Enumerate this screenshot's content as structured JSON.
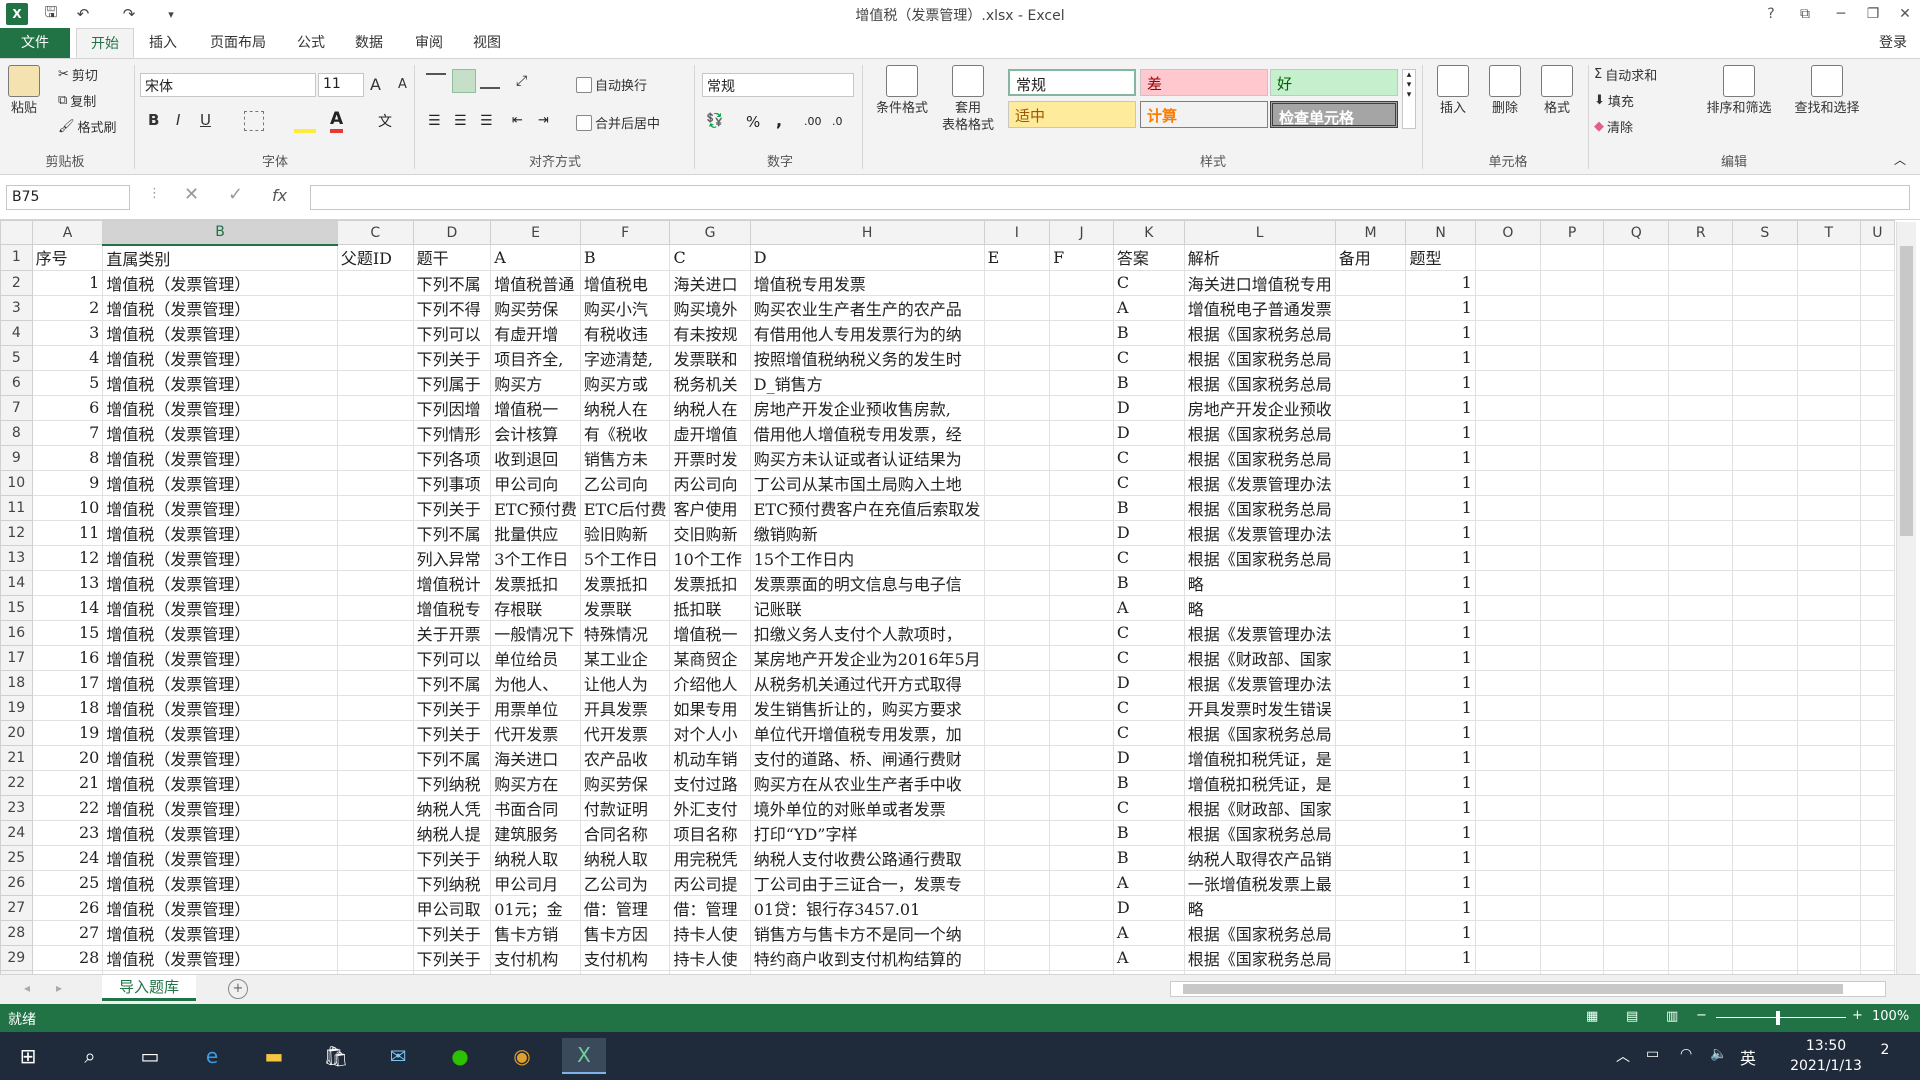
{
  "window": {
    "title": "增值税（发票管理）.xlsx - Excel",
    "login": "登录",
    "help": "?",
    "restore_ribbon": "⧉",
    "minimize": "─",
    "maximize": "❐",
    "close": "✕"
  },
  "qat": {
    "save_icon": "save-icon",
    "undo_icon": "undo-icon",
    "redo_icon": "redo-icon"
  },
  "tabs": [
    "文件",
    "开始",
    "插入",
    "页面布局",
    "公式",
    "数据",
    "审阅",
    "视图"
  ],
  "ribbon": {
    "clipboard": {
      "paste": "粘贴",
      "cut": "剪切",
      "copy": "复制",
      "format_painter": "格式刷",
      "label": "剪贴板"
    },
    "font": {
      "name": "宋体",
      "size": "11",
      "bold": "B",
      "italic": "I",
      "underline": "U",
      "grow": "A",
      "shrink": "A",
      "label": "字体"
    },
    "align": {
      "wrap": "自动换行",
      "merge": "合并后居中",
      "label": "对齐方式"
    },
    "number": {
      "format": "常规",
      "percent": "%",
      "comma": ",",
      "label": "数字"
    },
    "styles": {
      "cond": "条件格式",
      "table": "套用",
      "table2": "表格格式",
      "normal": "常规",
      "bad": "差",
      "good": "好",
      "neutral": "适中",
      "calc": "计算",
      "check": "检查单元格",
      "label": "样式"
    },
    "cells": {
      "insert": "插入",
      "delete": "删除",
      "format": "格式",
      "label": "单元格"
    },
    "editing": {
      "autosum": "自动求和",
      "fill": "填充",
      "clear": "清除",
      "sort": "排序和筛选",
      "find": "查找和选择",
      "label": "编辑"
    }
  },
  "formula_bar": {
    "name_box": "B75",
    "cancel": "✕",
    "enter": "✓",
    "fx": "fx",
    "value": ""
  },
  "columns": [
    "A",
    "B",
    "C",
    "D",
    "E",
    "F",
    "G",
    "H",
    "I",
    "J",
    "K",
    "L",
    "M",
    "N",
    "O",
    "P",
    "Q",
    "R",
    "S",
    "T",
    "U"
  ],
  "header_row": [
    "序号",
    "直属类别",
    "父题ID",
    "题干",
    "A",
    "B",
    "C",
    "D",
    "E",
    "F",
    "答案",
    "解析",
    "备用",
    "题型"
  ],
  "rows": [
    [
      "1",
      "增值税（发票管理）",
      "",
      "下列不属",
      "增值税普通",
      "增值税电",
      "海关进口",
      "增值税专用发票",
      "",
      "",
      "C",
      "海关进口增值税专用",
      "",
      "1"
    ],
    [
      "2",
      "增值税（发票管理）",
      "",
      "下列不得",
      "购买劳保",
      "购买小汽",
      "购买境外",
      "购买农业生产者生产的农产品",
      "",
      "",
      "A",
      "增值税电子普通发票",
      "",
      "1"
    ],
    [
      "3",
      "增值税（发票管理）",
      "",
      "下列可以",
      "有虚开增",
      "有税收违",
      "有未按规",
      "有借用他人专用发票行为的纳",
      "",
      "",
      "B",
      "根据《国家税务总局",
      "",
      "1"
    ],
    [
      "4",
      "增值税（发票管理）",
      "",
      "下列关于",
      "项目齐全,",
      "字迹清楚,",
      "发票联和",
      "按照增值税纳税义务的发生时",
      "",
      "",
      "C",
      "根据《国家税务总局",
      "",
      "1"
    ],
    [
      "5",
      "增值税（发票管理）",
      "",
      "下列属于",
      "购买方",
      "购买方或",
      "税务机关",
      "D_销售方",
      "",
      "",
      "B",
      "根据《国家税务总局",
      "",
      "1"
    ],
    [
      "6",
      "增值税（发票管理）",
      "",
      "下列因增",
      "增值税一",
      "纳税人在",
      "纳税人在",
      "房地产开发企业预收售房款,",
      "",
      "",
      "D",
      "房地产开发企业预收",
      "",
      "1"
    ],
    [
      "7",
      "增值税（发票管理）",
      "",
      "下列情形",
      "会计核算",
      "有《税收",
      "虚开增值",
      "借用他人增值税专用发票，经",
      "",
      "",
      "D",
      "根据《国家税务总局",
      "",
      "1"
    ],
    [
      "8",
      "增值税（发票管理）",
      "",
      "下列各项",
      "收到退回",
      "销售方未",
      "开票时发",
      "购买方未认证或者认证结果为",
      "",
      "",
      "C",
      "根据《国家税务总局",
      "",
      "1"
    ],
    [
      "9",
      "增值税（发票管理）",
      "",
      "下列事项",
      "甲公司向",
      "乙公司向",
      "丙公司向",
      "丁公司从某市国土局购入土地",
      "",
      "",
      "C",
      "根据《发票管理办法",
      "",
      "1"
    ],
    [
      "10",
      "增值税（发票管理）",
      "",
      "下列关于",
      "ETC预付费",
      "ETC后付费",
      "客户使用",
      "ETC预付费客户在充值后索取发",
      "",
      "",
      "B",
      "根据《国家税务总局",
      "",
      "1"
    ],
    [
      "11",
      "增值税（发票管理）",
      "",
      "下列不属",
      "批量供应",
      "验旧购新",
      "交旧购新",
      "缴销购新",
      "",
      "",
      "D",
      "根据《发票管理办法",
      "",
      "1"
    ],
    [
      "12",
      "增值税（发票管理）",
      "",
      "列入异常",
      "3个工作日",
      "5个工作日",
      "10个工作",
      "15个工作日内",
      "",
      "",
      "C",
      "根据《国家税务总局",
      "",
      "1"
    ],
    [
      "13",
      "增值税（发票管理）",
      "",
      "增值税计",
      "发票抵扣",
      "发票抵扣",
      "发票抵扣",
      "发票票面的明文信息与电子信",
      "",
      "",
      "B",
      "略",
      "",
      "1"
    ],
    [
      "14",
      "增值税（发票管理）",
      "",
      "增值税专",
      "存根联",
      "发票联",
      "抵扣联",
      "记账联",
      "",
      "",
      "A",
      "略",
      "",
      "1"
    ],
    [
      "15",
      "增值税（发票管理）",
      "",
      "关于开票",
      "一般情况下",
      "特殊情况",
      "增值税一",
      "扣缴义务人支付个人款项时，",
      "",
      "",
      "C",
      "根据《发票管理办法",
      "",
      "1"
    ],
    [
      "16",
      "增值税（发票管理）",
      "",
      "下列可以",
      "单位给员",
      "某工业企",
      "某商贸企",
      "某房地产开发企业为2016年5月",
      "",
      "",
      "C",
      "根据《财政部、国家",
      "",
      "1"
    ],
    [
      "17",
      "增值税（发票管理）",
      "",
      "下列不属",
      "为他人、",
      "让他人为",
      "介绍他人",
      "从税务机关通过代开方式取得",
      "",
      "",
      "D",
      "根据《发票管理办法",
      "",
      "1"
    ],
    [
      "18",
      "增值税（发票管理）",
      "",
      "下列关于",
      "用票单位",
      "开具发票",
      "如果专用",
      "发生销售折让的，购买方要求",
      "",
      "",
      "C",
      "开具发票时发生错误",
      "",
      "1"
    ],
    [
      "19",
      "增值税（发票管理）",
      "",
      "下列关于",
      "代开发票",
      "代开发票",
      "对个人小",
      "单位代开增值税专用发票，加",
      "",
      "",
      "C",
      "根据《国家税务总局",
      "",
      "1"
    ],
    [
      "20",
      "增值税（发票管理）",
      "",
      "下列不属",
      "海关进口",
      "农产品收",
      "机动车销",
      "支付的道路、桥、闸通行费财",
      "",
      "",
      "D",
      "增值税扣税凭证，是",
      "",
      "1"
    ],
    [
      "21",
      "增值税（发票管理）",
      "",
      "下列纳税",
      "购买方在",
      "购买劳保",
      "支付过路",
      "购买方在从农业生产者手中收",
      "",
      "",
      "B",
      "增值税扣税凭证，是",
      "",
      "1"
    ],
    [
      "22",
      "增值税（发票管理）",
      "",
      "纳税人凭",
      "书面合同",
      "付款证明",
      "外汇支付",
      "境外单位的对账单或者发票",
      "",
      "",
      "C",
      "根据《财政部、国家",
      "",
      "1"
    ],
    [
      "23",
      "增值税（发票管理）",
      "",
      "纳税人提",
      "建筑服务",
      "合同名称",
      "项目名称",
      "打印“YD”字样",
      "",
      "",
      "B",
      "根据《国家税务总局",
      "",
      "1"
    ],
    [
      "24",
      "增值税（发票管理）",
      "",
      "下列关于",
      "纳税人取",
      "纳税人取",
      "用完税凭",
      "纳税人支付收费公路通行费取",
      "",
      "",
      "B",
      "纳税人取得农产品销",
      "",
      "1"
    ],
    [
      "25",
      "增值税（发票管理）",
      "",
      "下列纳税",
      "甲公司月",
      "乙公司为",
      "丙公司提",
      "丁公司由于三证合一，发票专",
      "",
      "",
      "A",
      "一张增值税发票上最",
      "",
      "1"
    ],
    [
      "26",
      "增值税（发票管理）",
      "",
      "甲公司取",
      "01元；金",
      "借：管理",
      "借：管理",
      "01贷：银行存3457.01",
      "",
      "",
      "D",
      "略",
      "",
      "1"
    ],
    [
      "27",
      "增值税（发票管理）",
      "",
      "下列关于",
      "售卡方销",
      "售卡方因",
      "持卡人使",
      "销售方与售卡方不是同一个纳",
      "",
      "",
      "A",
      "根据《国家税务总局",
      "",
      "1"
    ],
    [
      "28",
      "增值税（发票管理）",
      "",
      "下列关于",
      "支付机构",
      "支付机构",
      "持卡人使",
      "特约商户收到支付机构结算的",
      "",
      "",
      "A",
      "根据《国家税务总局",
      "",
      "1"
    ],
    [
      "29",
      "增值税（发票管理）",
      "",
      "纳税人销",
      "增值税专",
      "增值税专",
      "增值税专",
      "增值税专用发票第六联",
      "",
      "",
      "D",
      "根据《国家税务总局",
      "",
      "1"
    ]
  ],
  "sheet_tab": "导入题库",
  "status": {
    "ready": "就绪",
    "zoom": "100%"
  },
  "taskbar": {
    "ime": "英",
    "time": "13:50",
    "date": "2021/1/13",
    "notif": "2"
  }
}
